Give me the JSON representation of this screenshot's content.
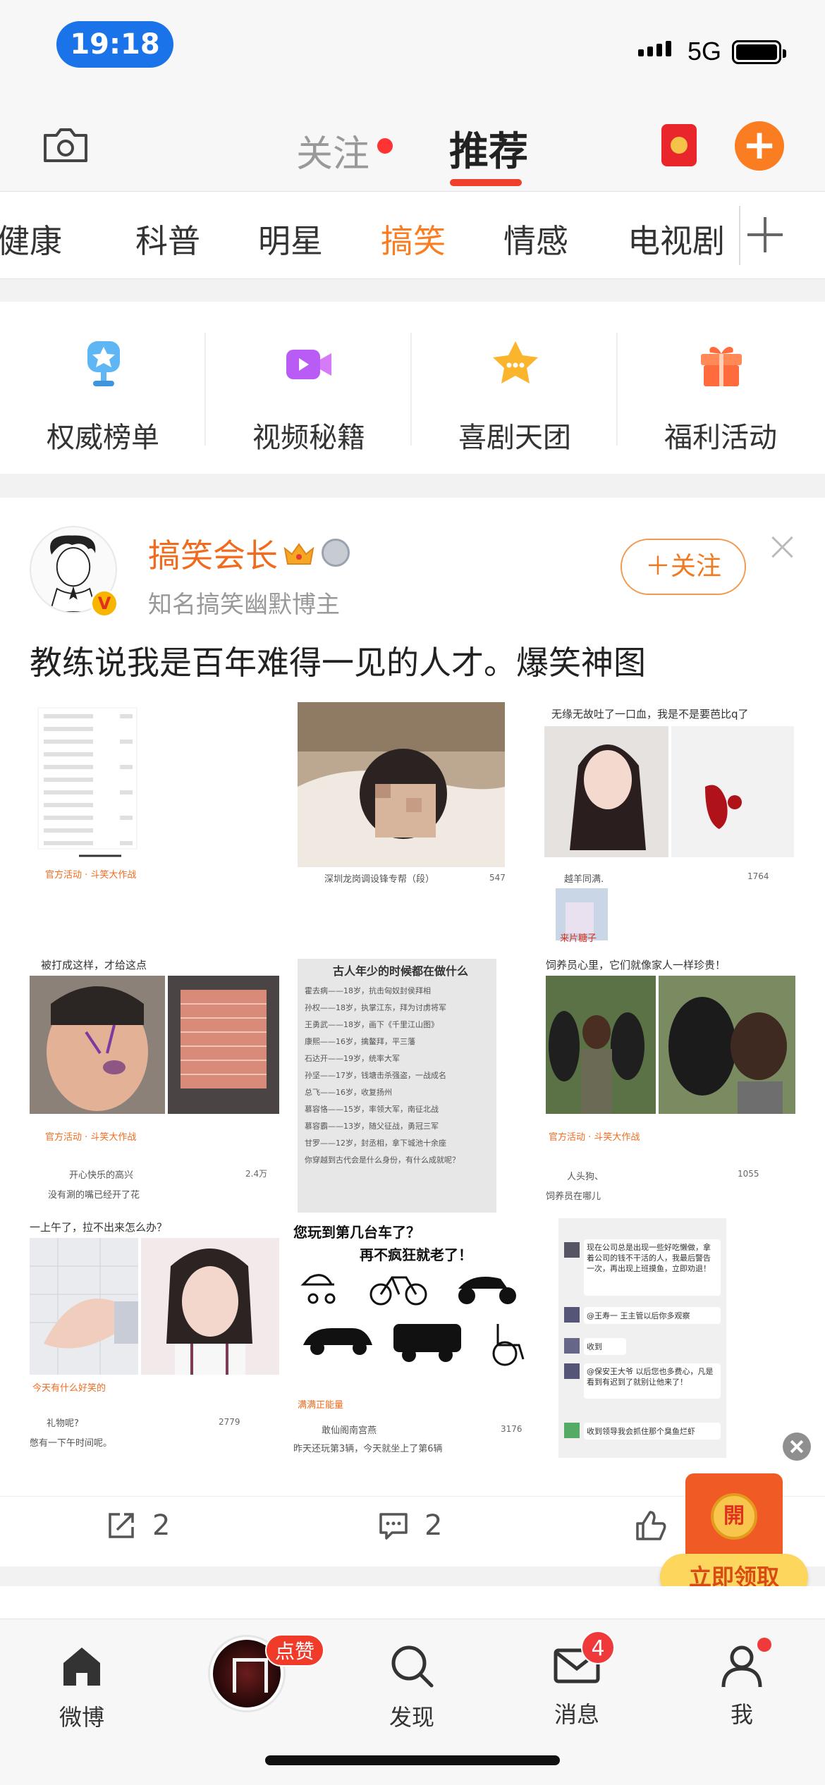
{
  "status": {
    "time": "19:18",
    "network": "5G"
  },
  "topnav": {
    "follow": "关注",
    "recommend": "推荐"
  },
  "categories": [
    "健康",
    "科普",
    "明星",
    "搞笑",
    "情感",
    "电视剧"
  ],
  "active_category": "搞笑",
  "quick": [
    {
      "label": "权威榜单",
      "icon": "trophy-icon"
    },
    {
      "label": "视频秘籍",
      "icon": "video-icon"
    },
    {
      "label": "喜剧天团",
      "icon": "star-chat-icon"
    },
    {
      "label": "福利活动",
      "icon": "gift-icon"
    }
  ],
  "post": {
    "author": "搞笑会长",
    "subtitle": "知名搞笑幽默博主",
    "follow_label": "＋关注",
    "text": "教练说我是百年难得一见的人才。爆笑神图",
    "images": {
      "p3_cap": "无缘无故吐了一口血，我是不是要芭比q了",
      "p3_user": "越羊同满.",
      "p3_count": "1764",
      "p3_caption2": "来片糖子",
      "p1_tag": "官方活动 · 斗笑大作战",
      "p2_user": "深圳龙岗调设锋专帮（段）",
      "p2_count": "547",
      "p4_cap": "被打成这样，才给这点",
      "p4_tag": "官方活动 · 斗笑大作战",
      "p4_user": "开心快乐的高兴",
      "p4_count": "2.4万",
      "p4_comment": "没有涮的嘴已经开了花",
      "p5_title": "古人年少的时候都在做什么",
      "p5_lines": [
        "霍去病——18岁，抗击匈奴封侯拜相",
        "孙权——18岁，执掌江东，拜为讨虏将军",
        "王勇武——18岁，画下《千里江山图》",
        "康熙——16岁，擒鳌拜，平三藩",
        "石达开——19岁，统率大军",
        "孙坚——17岁，钱塘击杀强盗，一战成名",
        "总飞——16岁，收复扬州",
        "慕容恪——15岁，率领大军，南征北战",
        "慕容霸——13岁，随父征战，勇冠三军",
        "甘罗——12岁，封丞相，拿下城池十余座",
        "你穿越到古代会是什么身份，有什么成就呢？"
      ],
      "p6_cap": "饲养员心里，它们就像家人一样珍贵！",
      "p6_tag": "官方活动 · 斗笑大作战",
      "p6_user": "人头狗、",
      "p6_count": "1055",
      "p6_comment": "饲养员在哪儿",
      "p7_cap": "一上午了，拉不出来怎么办？",
      "p7_tag": "今天有什么好笑的",
      "p7_user": "礼物呢?",
      "p7_count": "2779",
      "p7_comment": "憋有一下午时间呢。",
      "p8_cap": "您玩到第几台车了？",
      "p8_sub": "再不疯狂就老了！",
      "p8_tag": "满满正能量",
      "p8_user": "敢仙阁南宫燕",
      "p8_count": "3176",
      "p8_comment": "昨天还玩第3辆，今天就坐上了第6辆",
      "p9_b1": "现在公司总是出现一些好吃懒做，拿着公司的钱不干活的人，我最后警告一次，再出现上班摸鱼，立即劝退！",
      "p9_b2": "@王寿一 王主管以后你多观察",
      "p9_b3": "收到",
      "p9_b4": "@保安王大爷 以后您也多费心，凡是看到有迟到了就别让他来了！",
      "p9_b5": "收到领导我会抓住那个臭鱼烂虾"
    },
    "reposts": "2",
    "comments": "2"
  },
  "redpacket": {
    "coin": "開",
    "button": "立即领取"
  },
  "tabbar": [
    {
      "label": "微博",
      "icon": "home-icon"
    },
    {
      "label": "发现",
      "icon": "discover-icon"
    },
    {
      "label": "消息",
      "icon": "mail-icon",
      "badge": "4"
    },
    {
      "label": "我",
      "icon": "profile-icon"
    }
  ],
  "center_badge": "点赞",
  "colors": {
    "accent": "#fa7d22",
    "brand_red": "#f03f2a",
    "status_pill": "#1a73e8"
  }
}
